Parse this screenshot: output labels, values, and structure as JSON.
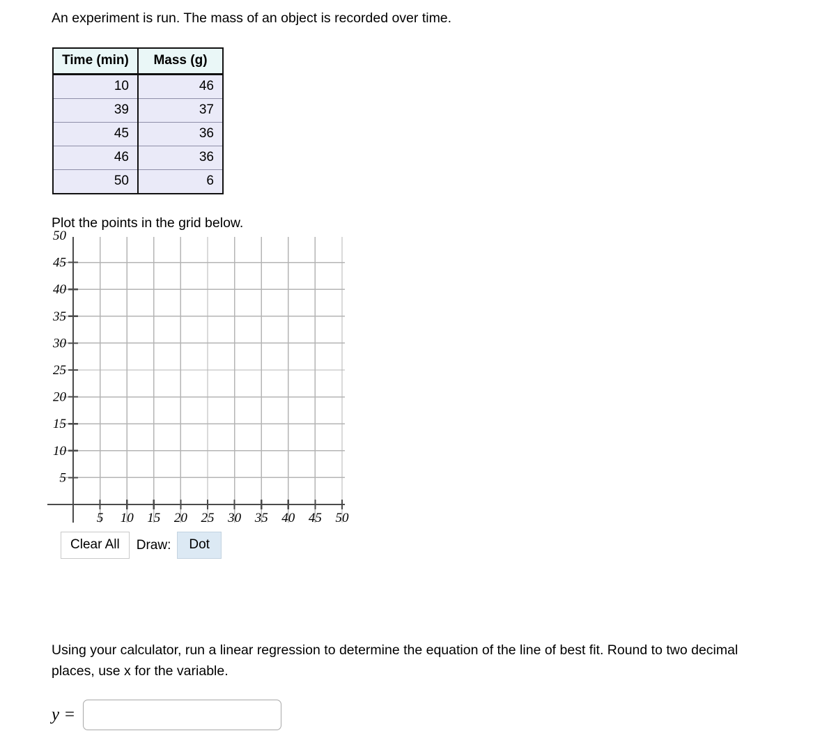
{
  "intro_text": "An experiment is run. The mass of an object is recorded over time.",
  "plot_instruction": "Plot the points in the grid below.",
  "regression_instruction": "Using your calculator, run a linear regression to determine the equation of the line of best fit. Round to two decimal places, use x for the variable.",
  "table": {
    "headers": [
      "Time (min)",
      "Mass (g)"
    ],
    "rows": [
      [
        "10",
        "46"
      ],
      [
        "39",
        "37"
      ],
      [
        "45",
        "36"
      ],
      [
        "46",
        "36"
      ],
      [
        "50",
        "6"
      ]
    ],
    "header_bg": "#eaf7f7",
    "cell_bg": "#eaeaf8",
    "border_color": "#111111"
  },
  "graph": {
    "y_tick_labels": [
      "50",
      "45",
      "40",
      "35",
      "30",
      "25",
      "20",
      "15",
      "10",
      "5"
    ],
    "x_tick_labels": [
      "5",
      "10",
      "15",
      "20",
      "25",
      "30",
      "35",
      "40",
      "45",
      "50"
    ],
    "x_min": 0,
    "x_max": 52,
    "y_min": 0,
    "y_max": 52,
    "step": 5,
    "grid_color": "#b4b4b4",
    "axis_color": "#4a4a4a",
    "plotted_points": []
  },
  "toolbar": {
    "clear_all_label": "Clear All",
    "draw_label": "Draw:",
    "dot_label": "Dot",
    "dot_selected": true,
    "dot_selected_bg": "#dce9f4"
  },
  "answer": {
    "prefix": "y =",
    "value": "",
    "placeholder": ""
  },
  "chart_data": {
    "type": "scatter",
    "title": "",
    "xlabel": "Time (min)",
    "ylabel": "Mass (g)",
    "x": [
      10,
      39,
      45,
      46,
      50
    ],
    "y": [
      46,
      37,
      36,
      36,
      6
    ],
    "xlim": [
      0,
      52
    ],
    "ylim": [
      0,
      52
    ],
    "xticks": [
      5,
      10,
      15,
      20,
      25,
      30,
      35,
      40,
      45,
      50
    ],
    "yticks": [
      5,
      10,
      15,
      20,
      25,
      30,
      35,
      40,
      45,
      50
    ],
    "grid": true,
    "legend": "none",
    "note": "Empty plotting grid provided for the student; table values listed as x/y are the data to be plotted."
  }
}
